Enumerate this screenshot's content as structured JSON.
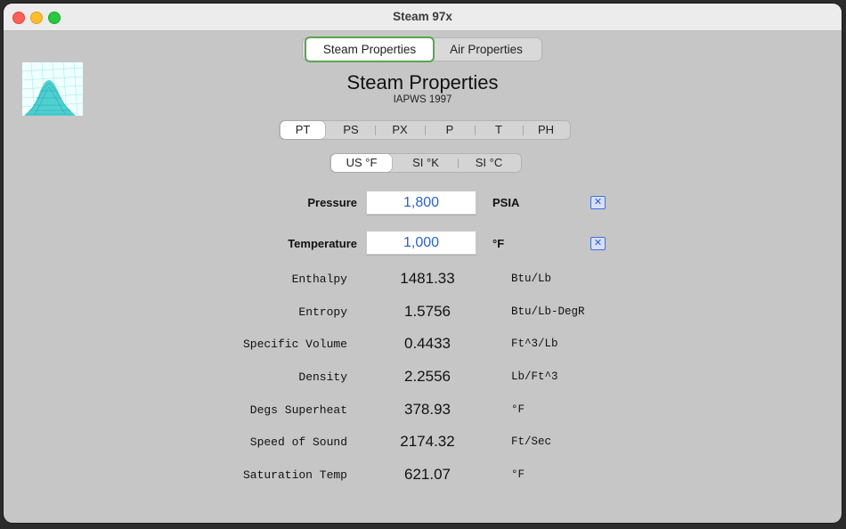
{
  "window": {
    "title": "Steam 97x"
  },
  "tabs": [
    {
      "label": "Steam Properties",
      "active": true
    },
    {
      "label": "Air Properties",
      "active": false
    }
  ],
  "heading": {
    "title": "Steam Properties",
    "subtitle": "IAPWS 1997"
  },
  "mode_selector": {
    "options": [
      "PT",
      "PS",
      "PX",
      "P",
      "T",
      "PH"
    ],
    "selected": "PT"
  },
  "unit_selector": {
    "options": [
      "US °F",
      "SI °K",
      "SI °C"
    ],
    "selected": "US °F"
  },
  "inputs": {
    "pressure": {
      "label": "Pressure",
      "value": "1,800",
      "unit": "PSIA",
      "clear_icon": "x-box-icon"
    },
    "temperature": {
      "label": "Temperature",
      "value": "1,000",
      "unit": "°F",
      "clear_icon": "x-box-icon"
    }
  },
  "results": [
    {
      "label": "Enthalpy",
      "value": "1481.33",
      "unit": "Btu/Lb"
    },
    {
      "label": "Entropy",
      "value": "1.5756",
      "unit": "Btu/Lb-DegR"
    },
    {
      "label": "Specific Volume",
      "value": "0.4433",
      "unit": "Ft^3/Lb"
    },
    {
      "label": "Density",
      "value": "2.2556",
      "unit": "Lb/Ft^3"
    },
    {
      "label": "Degs Superheat",
      "value": "378.93",
      "unit": "°F"
    },
    {
      "label": "Speed of Sound",
      "value": "2174.32",
      "unit": "Ft/Sec"
    },
    {
      "label": "Saturation Temp",
      "value": "621.07",
      "unit": "°F"
    }
  ],
  "colors": {
    "input_text": "#2a63c4",
    "active_tab_border": "#59a552",
    "logo_fill": "#5fd3d3"
  }
}
